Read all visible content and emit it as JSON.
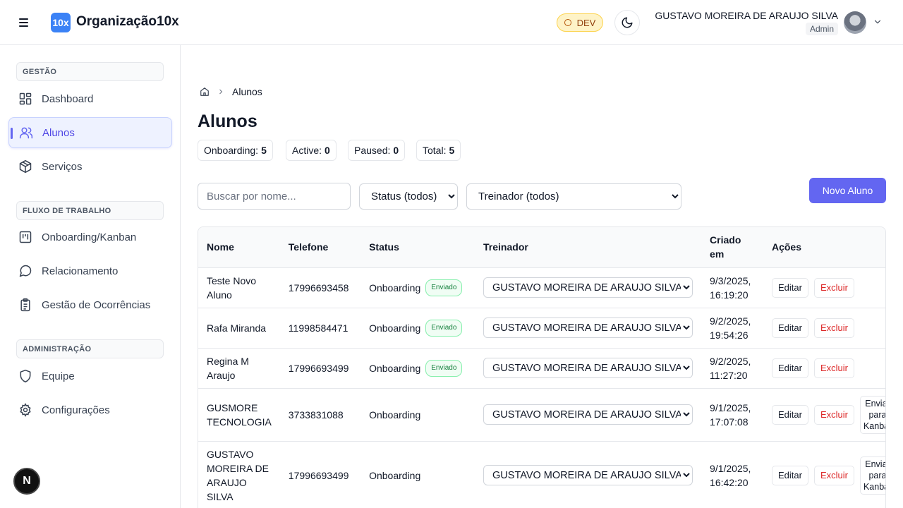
{
  "header": {
    "logo_badge": "10x",
    "org_name": "Organização10x",
    "env_badge": "DEV",
    "user_name": "GUSTAVO MOREIRA DE ARAUJO SILVA",
    "user_role": "Admin"
  },
  "sidebar": {
    "sections": [
      {
        "label": "GESTÃO"
      },
      {
        "label": "FLUXO DE TRABALHO"
      },
      {
        "label": "ADMINISTRAÇÃO"
      }
    ],
    "items": [
      {
        "label": "Dashboard",
        "icon": "dashboard-icon"
      },
      {
        "label": "Alunos",
        "icon": "users-icon",
        "active": true
      },
      {
        "label": "Serviços",
        "icon": "package-icon"
      },
      {
        "label": "Onboarding/Kanban",
        "icon": "kanban-icon"
      },
      {
        "label": "Relacionamento",
        "icon": "chat-icon"
      },
      {
        "label": "Gestão de Ocorrências",
        "icon": "clipboard-icon"
      },
      {
        "label": "Equipe",
        "icon": "shield-icon"
      },
      {
        "label": "Configurações",
        "icon": "gear-icon"
      }
    ],
    "footer_badge": "N"
  },
  "breadcrumb": {
    "current": "Alunos"
  },
  "page": {
    "title": "Alunos"
  },
  "stats": [
    {
      "label": "Onboarding:",
      "value": "5"
    },
    {
      "label": "Active:",
      "value": "0"
    },
    {
      "label": "Paused:",
      "value": "0"
    },
    {
      "label": "Total:",
      "value": "5"
    }
  ],
  "filters": {
    "search_placeholder": "Buscar por nome...",
    "status_selected": "Status (todos)",
    "trainer_selected": "Treinador (todos)",
    "new_button": "Novo Aluno"
  },
  "table": {
    "headers": [
      "Nome",
      "Telefone",
      "Status",
      "Treinador",
      "Criado em",
      "Ações"
    ],
    "actions": {
      "edit": "Editar",
      "delete": "Excluir",
      "send": "Enviar para Kanban"
    },
    "rows": [
      {
        "nome": "Teste Novo Aluno",
        "telefone": "17996693458",
        "status": "Onboarding",
        "badge": "Enviado",
        "treinador": "GUSTAVO MOREIRA DE ARAUJO SILVA",
        "criado": "9/3/2025, 16:19:20"
      },
      {
        "nome": "Rafa Miranda",
        "telefone": "11998584471",
        "status": "Onboarding",
        "badge": "Enviado",
        "treinador": "GUSTAVO MOREIRA DE ARAUJO SILVA",
        "criado": "9/2/2025, 19:54:26"
      },
      {
        "nome": "Regina M Araujo",
        "telefone": "17996693499",
        "status": "Onboarding",
        "badge": "Enviado",
        "treinador": "GUSTAVO MOREIRA DE ARAUJO SILVA",
        "criado": "9/2/2025, 11:27:20"
      },
      {
        "nome": "GUSMORE TECNOLOGIA",
        "telefone": "3733831088",
        "status": "Onboarding",
        "badge": "",
        "treinador": "GUSTAVO MOREIRA DE ARAUJO SILVA",
        "criado": "9/1/2025, 17:07:08"
      },
      {
        "nome": "GUSTAVO MOREIRA DE ARAUJO SILVA",
        "telefone": "17996693499",
        "status": "Onboarding",
        "badge": "",
        "treinador": "GUSTAVO MOREIRA DE ARAUJO SILVA",
        "criado": "9/1/2025, 16:42:20"
      }
    ]
  }
}
